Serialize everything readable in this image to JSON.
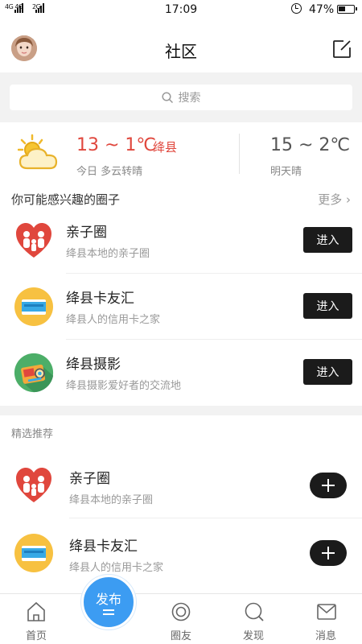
{
  "status_bar": {
    "network_top": "4G 4G",
    "network_bottom": "2G",
    "time": "17:09",
    "battery": "47%",
    "battery_level": 0.47
  },
  "header": {
    "title": "社区",
    "avatar_icon": "user-avatar",
    "edit_icon": "edit-icon"
  },
  "search": {
    "placeholder": "搜索",
    "icon": "search-icon"
  },
  "weather": {
    "today_temp": "13 ~ 1℃",
    "city": "绛县",
    "today_desc": "今日 多云转晴",
    "tomorrow_temp": "15 ~ 2℃",
    "tomorrow_desc": "明天晴",
    "icon": "partly-cloudy-icon"
  },
  "interest_section": {
    "title": "你可能感兴趣的圈子",
    "more": "更多",
    "items": [
      {
        "name": "亲子圈",
        "desc": "绛县本地的亲子圈",
        "button": "进入",
        "icon": "family-heart-icon"
      },
      {
        "name": "绛县卡友汇",
        "desc": "绛县人的信用卡之家",
        "button": "进入",
        "icon": "credit-card-icon"
      },
      {
        "name": "绛县摄影",
        "desc": "绛县摄影爱好者的交流地",
        "button": "进入",
        "icon": "camera-icon"
      }
    ]
  },
  "featured_section": {
    "title": "精选推荐",
    "items": [
      {
        "name": "亲子圈",
        "desc": "绛县本地的亲子圈",
        "icon": "family-heart-icon"
      },
      {
        "name": "绛县卡友汇",
        "desc": "绛县人的信用卡之家",
        "icon": "credit-card-icon"
      }
    ]
  },
  "tabbar": {
    "home": "首页",
    "publish": "发布",
    "friends": "圈友",
    "discover": "发现",
    "messages": "消息"
  },
  "colors": {
    "accent_red": "#e0473d",
    "publish_blue": "#3c9cf2",
    "button_dark": "#1b1b1b"
  }
}
